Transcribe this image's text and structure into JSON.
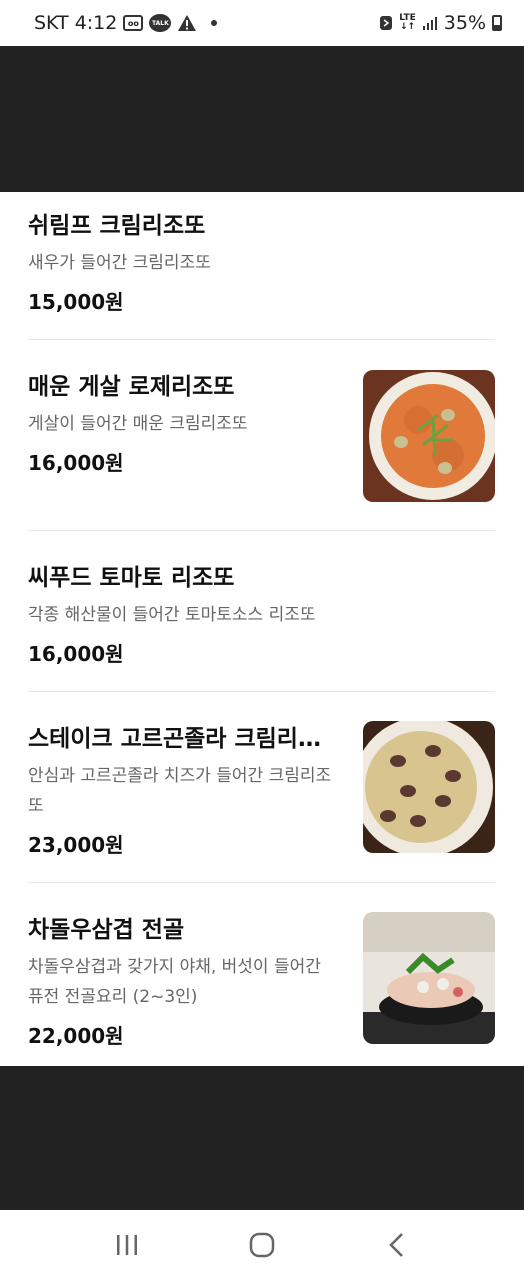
{
  "status": {
    "carrier_time": "SKT 4:12",
    "voicemail_icon": "voicemail-icon",
    "talk_icon_label": "TALK",
    "network": "LTE",
    "battery": "35%"
  },
  "menu": [
    {
      "name": "쉬림프 크림리조또",
      "desc": "새우가 들어간 크림리조또",
      "price": "15,000원"
    },
    {
      "name": "매운 게살 로제리조또",
      "desc": "게살이 들어간 매운 크림리조또",
      "price": "16,000원",
      "image": "risotto-rose-photo"
    },
    {
      "name": "씨푸드 토마토 리조또",
      "desc": "각종 해산물이 들어간 토마토소스 리조또",
      "price": "16,000원"
    },
    {
      "name": "스테이크 고르곤졸라 크림리조또",
      "desc": "안심과 고르곤졸라 치즈가 들어간 크림리조또",
      "price": "23,000원",
      "image": "steak-gorgonzola-photo"
    },
    {
      "name": "차돌우삼겹 전골",
      "desc": "차돌우삼겹과 갖가지 야채, 버섯이 들어간 퓨전 전골요리 (2~3인)",
      "price": "22,000원",
      "image": "hotpot-photo"
    }
  ],
  "nav": {
    "recent": "recent-apps-icon",
    "home": "home-icon",
    "back": "back-icon"
  }
}
